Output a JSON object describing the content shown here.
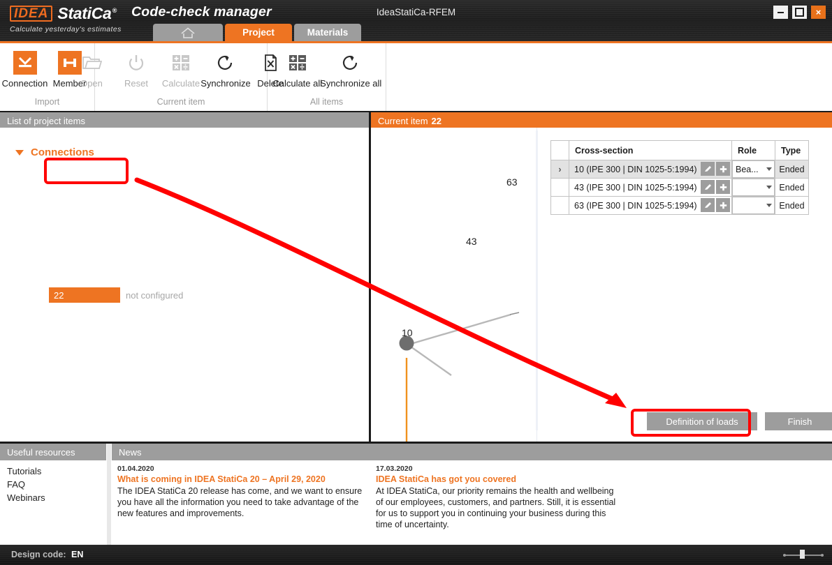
{
  "window": {
    "title": "IdeaStatiCa-RFEM",
    "app_subtitle": "Code-check manager",
    "logo_mark": "IDEA",
    "logo_name": "StatiCa",
    "logo_reg": "®",
    "tagline": "Calculate yesterday's estimates",
    "buttons": {
      "minimize": "minimize",
      "maximize": "maximize",
      "close": "×"
    }
  },
  "tabs": [
    {
      "label": "",
      "icon": "home-icon",
      "active": false
    },
    {
      "label": "Project",
      "icon": "",
      "active": true
    },
    {
      "label": "Materials",
      "icon": "",
      "active": false
    }
  ],
  "ribbon": {
    "groups": [
      {
        "label": "Import",
        "items": [
          {
            "label": "Connection",
            "icon": "connection-icon",
            "enabled": true
          },
          {
            "label": "Member",
            "icon": "member-icon",
            "enabled": true
          }
        ]
      },
      {
        "label": "Current item",
        "items": [
          {
            "label": "Open",
            "icon": "folder-open-icon",
            "enabled": false
          },
          {
            "label": "Reset",
            "icon": "power-reset-icon",
            "enabled": false
          },
          {
            "label": "Calculate",
            "icon": "calculator-icon",
            "enabled": false
          },
          {
            "label": "Synchronize",
            "icon": "refresh-icon",
            "enabled": true
          },
          {
            "label": "Delete",
            "icon": "delete-file-icon",
            "enabled": true
          }
        ]
      },
      {
        "label": "All items",
        "items": [
          {
            "label": "Calculate all",
            "icon": "calculator-icon",
            "enabled": true
          },
          {
            "label": "Synchronize all",
            "icon": "refresh-icon",
            "enabled": true
          }
        ]
      }
    ]
  },
  "left_panel": {
    "header": "List of project items",
    "group_label": "Connections",
    "selected_item": "22",
    "item_status": "not configured"
  },
  "current_item": {
    "header_prefix": "Current item",
    "header_value": "22",
    "viewport": {
      "labels": [
        {
          "text": "63"
        },
        {
          "text": "43"
        },
        {
          "text": "10"
        }
      ],
      "colors": {
        "node": "#6e6e6e",
        "member": "#f0921e",
        "line": "#b8b8b8",
        "plate": "#f4716d"
      }
    },
    "table": {
      "columns": [
        "",
        "Cross-section",
        "Role",
        "Type"
      ],
      "rows": [
        {
          "marker": "›",
          "cross_section": "10 (IPE 300 | DIN 1025-5:1994)",
          "role": "Bea...",
          "type": "Ended",
          "selected": true
        },
        {
          "marker": "",
          "cross_section": "43 (IPE 300 | DIN 1025-5:1994)",
          "role": "",
          "type": "Ended",
          "selected": false
        },
        {
          "marker": "",
          "cross_section": "63 (IPE 300 | DIN 1025-5:1994)",
          "role": "",
          "type": "Ended",
          "selected": false
        }
      ],
      "row_buttons": {
        "edit": "edit-icon",
        "add": "add-icon"
      }
    },
    "actions": {
      "definition_of_loads": "Definition of loads",
      "finish": "Finish"
    }
  },
  "resources": {
    "header": "Useful resources",
    "items": [
      "Tutorials",
      "FAQ",
      "Webinars"
    ]
  },
  "news": {
    "header": "News",
    "items": [
      {
        "date": "01.04.2020",
        "title": "What is coming in IDEA StatiCa 20 – April 29, 2020",
        "text": "The IDEA StatiCa 20 release has come, and we want to ensure you have all the information you need to take advantage of the new features and improvements."
      },
      {
        "date": "17.03.2020",
        "title": "IDEA StatiCa has got you covered",
        "text": "At IDEA StatiCa, our priority remains the health and wellbeing of our employees, customers, and partners. Still, it is essential for us to support you in continuing your business during this time of uncertainty."
      }
    ]
  },
  "statusbar": {
    "design_code_label": "Design code:",
    "design_code_value": "EN"
  },
  "colors": {
    "accent_orange": "#ee7422",
    "header_gray": "#9d9d9d",
    "annotation_red": "#ff0000"
  }
}
